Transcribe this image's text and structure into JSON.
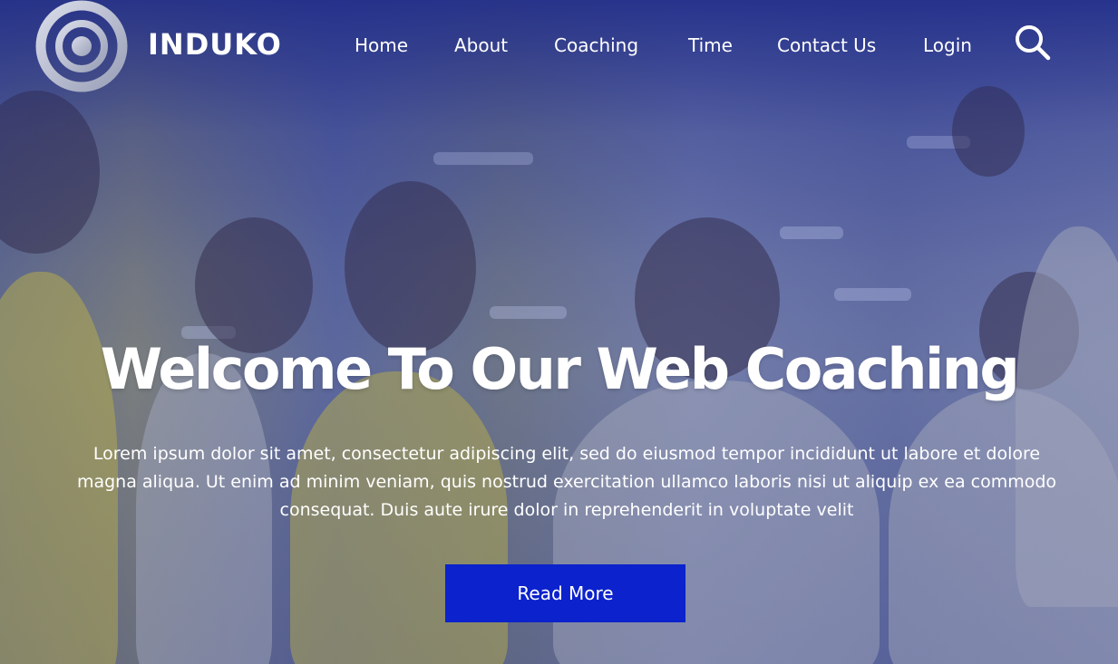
{
  "brand": {
    "name": "INDUKO",
    "logo_icon": "concentric-rings-icon"
  },
  "nav": {
    "items": [
      {
        "label": "Home"
      },
      {
        "label": "About"
      },
      {
        "label": "Coaching"
      },
      {
        "label": "Time"
      },
      {
        "label": "Contact Us"
      },
      {
        "label": "Login"
      }
    ],
    "search_icon": "search-icon"
  },
  "hero": {
    "title": "Welcome To Our Web Coaching",
    "text": "Lorem ipsum dolor sit amet, consectetur adipiscing elit, sed do eiusmod tempor incididunt ut labore et dolore magna aliqua. Ut enim ad minim veniam, quis nostrud exercitation ullamco laboris nisi ut aliquip ex ea commodo consequat. Duis aute irure dolor in reprehenderit in voluptate velit",
    "button_label": "Read More"
  },
  "colors": {
    "overlay": "#2a3b9c",
    "button": "#0b22cc",
    "text": "#ffffff"
  }
}
